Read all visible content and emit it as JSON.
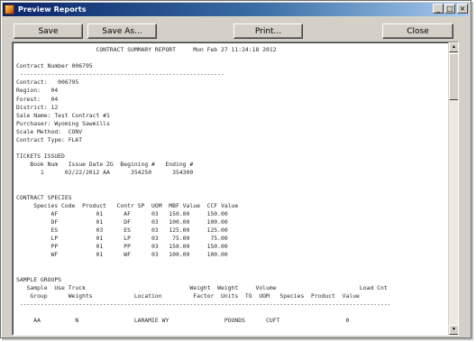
{
  "window": {
    "title": "Preview Reports",
    "controls": {
      "minimize": "_",
      "maximize": "□",
      "close": "×"
    }
  },
  "toolbar": {
    "save": "Save",
    "save_as": "Save As...",
    "print": "Print...",
    "close": "Close"
  },
  "report": {
    "header": "                       CONTRACT SUMMARY REPORT     Mon Feb 27 11:24:18 2012",
    "contract_number_line": "Contract Number 006795",
    "rule": " -----------------------------------------------------------",
    "details": [
      "Contract:   006795",
      "Region:   04",
      "Forest:   04",
      "District: 12",
      "Sale Name: Test Contract #1",
      "Purchaser: Wyoming Sawmills",
      "Scale Method:  CONV",
      "Contract Type: FLAT"
    ],
    "tickets": {
      "heading": "TICKETS ISSUED",
      "columns": "    Book Num   Issue Date ZG  Begining #   Ending #",
      "row": "       1      02/22/2012 AA      354250      354300"
    },
    "species": {
      "heading": "CONTRACT SPECIES",
      "columns": "     Species Code  Product   Contr SP  UOM  MBF Value  CCF Value",
      "rows": [
        "          AF           01      AF      03   150.00     150.00",
        "          DF           01      DF      03   100.00     100.00",
        "          ES           03      ES      03   125.00     125.00",
        "          LP           01      LP      03    75.00      75.00",
        "          PP           01      PP      03   150.00     150.00",
        "          WF           01      WF      03   100.00     100.00"
      ]
    },
    "sample_groups": {
      "heading": "SAMPLE GROUPS",
      "header_line_1": "   Sample  Use Truck                              Weight  Weight     Volume                        Load Cnt",
      "header_line_2": "    Group      Weights            Location         Factor  Units  TO  UOM   Species  Product  Value",
      "rule": " -----------------------------------------------------------------------------------------------------------",
      "row": "     AA          N                LARAMIE WY                POUNDS      CUFT                   0"
    }
  }
}
